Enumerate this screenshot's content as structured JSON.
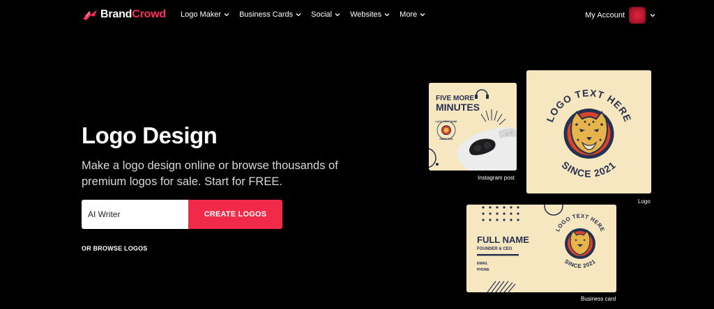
{
  "nav": {
    "brand_part1": "Brand",
    "brand_part2": "Crowd",
    "menu": [
      "Logo Maker",
      "Business Cards",
      "Social",
      "Websites",
      "More"
    ],
    "account_label": "My Account"
  },
  "hero": {
    "title": "Logo Design",
    "subtitle": "Make a logo design online or browse thousands of premium logos for sale. Start for FREE.",
    "input_value": "AI Writer",
    "cta_label": "CREATE LOGOS",
    "browse_label": "OR BROWSE LOGOS"
  },
  "previews": {
    "instagram": {
      "line1": "FIVE MORE",
      "line2": "MINUTES",
      "badge_top": "LOGO TEXT HERE",
      "badge_bottom": "SINCE 2021",
      "caption": "Instagram post"
    },
    "logo": {
      "arc_top": "LOGO TEXT HERE",
      "arc_bottom": "SINCE 2021",
      "caption": "Logo"
    },
    "business_card": {
      "name": "FULL NAME",
      "role": "FOUNDER & CEO",
      "email": "EMAIL",
      "phone": "PHONE",
      "arc_top": "LOGO TEXT HERE",
      "arc_bottom": "SINCE 2021",
      "caption": "Business card"
    }
  },
  "colors": {
    "brand_accent": "#ff2f55",
    "cta": "#f02a48",
    "card_bg": "#f6e7c1",
    "navy": "#26304f",
    "emblem_red": "#d9452b"
  }
}
